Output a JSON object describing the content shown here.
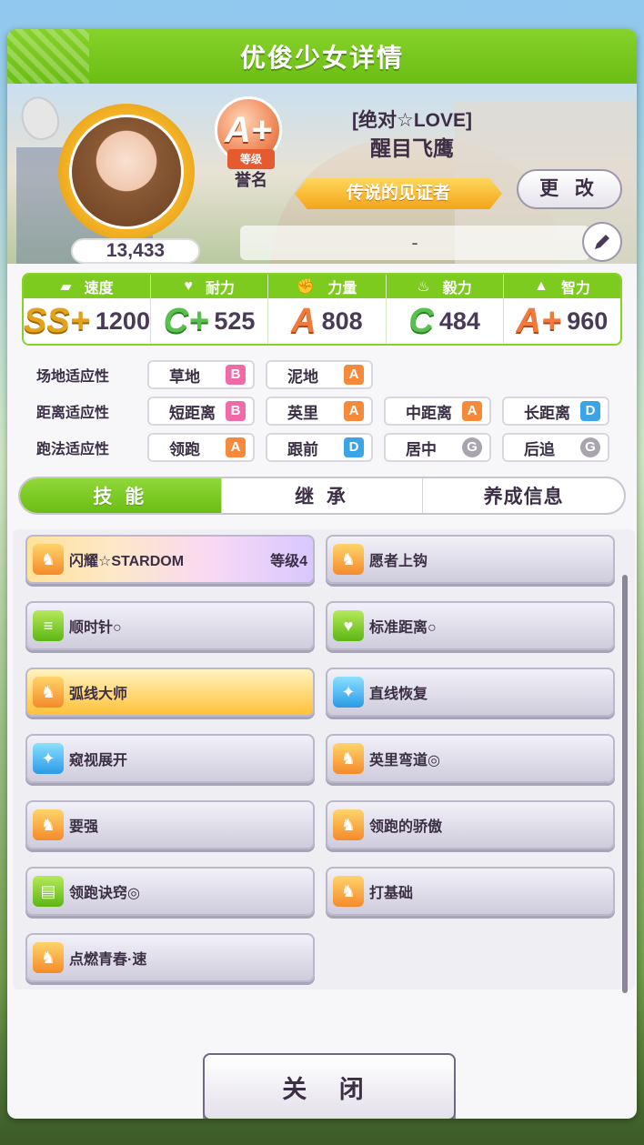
{
  "title": "优俊少女详情",
  "profile": {
    "fans": "13,433",
    "rank_grade": "A+",
    "rank_badge_label": "等级",
    "rank_caption": "誉名",
    "epithet": "[绝对☆LOVE]",
    "name": "醒目飞鹰",
    "title_ribbon": "传说的见证者",
    "change_label": "更 改",
    "comment": "-"
  },
  "stats": [
    {
      "label": "速度",
      "icon": "shoe-icon",
      "grade": "SS+",
      "value": "1200"
    },
    {
      "label": "耐力",
      "icon": "heart-icon",
      "grade": "C+",
      "value": "525"
    },
    {
      "label": "力量",
      "icon": "muscle-icon",
      "grade": "A",
      "value": "808"
    },
    {
      "label": "毅力",
      "icon": "flame-icon",
      "grade": "C",
      "value": "484"
    },
    {
      "label": "智力",
      "icon": "graduation-cap-icon",
      "grade": "A+",
      "value": "960"
    }
  ],
  "aptitude": {
    "track": {
      "label": "场地适应性",
      "items": [
        {
          "name": "草地",
          "grade": "B"
        },
        {
          "name": "泥地",
          "grade": "A"
        }
      ]
    },
    "distance": {
      "label": "距离适应性",
      "items": [
        {
          "name": "短距离",
          "grade": "B"
        },
        {
          "name": "英里",
          "grade": "A"
        },
        {
          "name": "中距离",
          "grade": "A"
        },
        {
          "name": "长距离",
          "grade": "D"
        }
      ]
    },
    "style": {
      "label": "跑法适应性",
      "items": [
        {
          "name": "领跑",
          "grade": "A"
        },
        {
          "name": "跟前",
          "grade": "D"
        },
        {
          "name": "居中",
          "grade": "G"
        },
        {
          "name": "后追",
          "grade": "G"
        }
      ]
    }
  },
  "tabs": [
    "技 能",
    "继 承",
    "养成信息"
  ],
  "skills": [
    {
      "name": "闪耀☆STARDOM",
      "level": "等级4",
      "icon": "horse-icon",
      "style": "rare"
    },
    {
      "name": "愿者上钩",
      "level": "",
      "icon": "horse-icon",
      "style": "normal"
    },
    {
      "name": "顺时针○",
      "level": "",
      "icon": "speed-lines-icon",
      "style": "normal"
    },
    {
      "name": "标准距离○",
      "level": "",
      "icon": "heart-icon",
      "style": "normal"
    },
    {
      "name": "弧线大师",
      "level": "",
      "icon": "horse-icon",
      "style": "gold"
    },
    {
      "name": "直线恢复",
      "level": "",
      "icon": "sparkle-icon",
      "style": "normal"
    },
    {
      "name": "窥视展开",
      "level": "",
      "icon": "sparkle-icon",
      "style": "normal"
    },
    {
      "name": "英里弯道◎",
      "level": "",
      "icon": "horse-icon",
      "style": "normal"
    },
    {
      "name": "要强",
      "level": "",
      "icon": "horse-icon",
      "style": "normal"
    },
    {
      "name": "领跑的骄傲",
      "level": "",
      "icon": "horse-icon",
      "style": "normal"
    },
    {
      "name": "领跑诀窍◎",
      "level": "",
      "icon": "book-icon",
      "style": "normal"
    },
    {
      "name": "打基础",
      "level": "",
      "icon": "horse-icon",
      "style": "normal"
    },
    {
      "name": "点燃青春·速",
      "level": "",
      "icon": "horse-icon",
      "style": "normal"
    }
  ],
  "close_label": "关 闭"
}
